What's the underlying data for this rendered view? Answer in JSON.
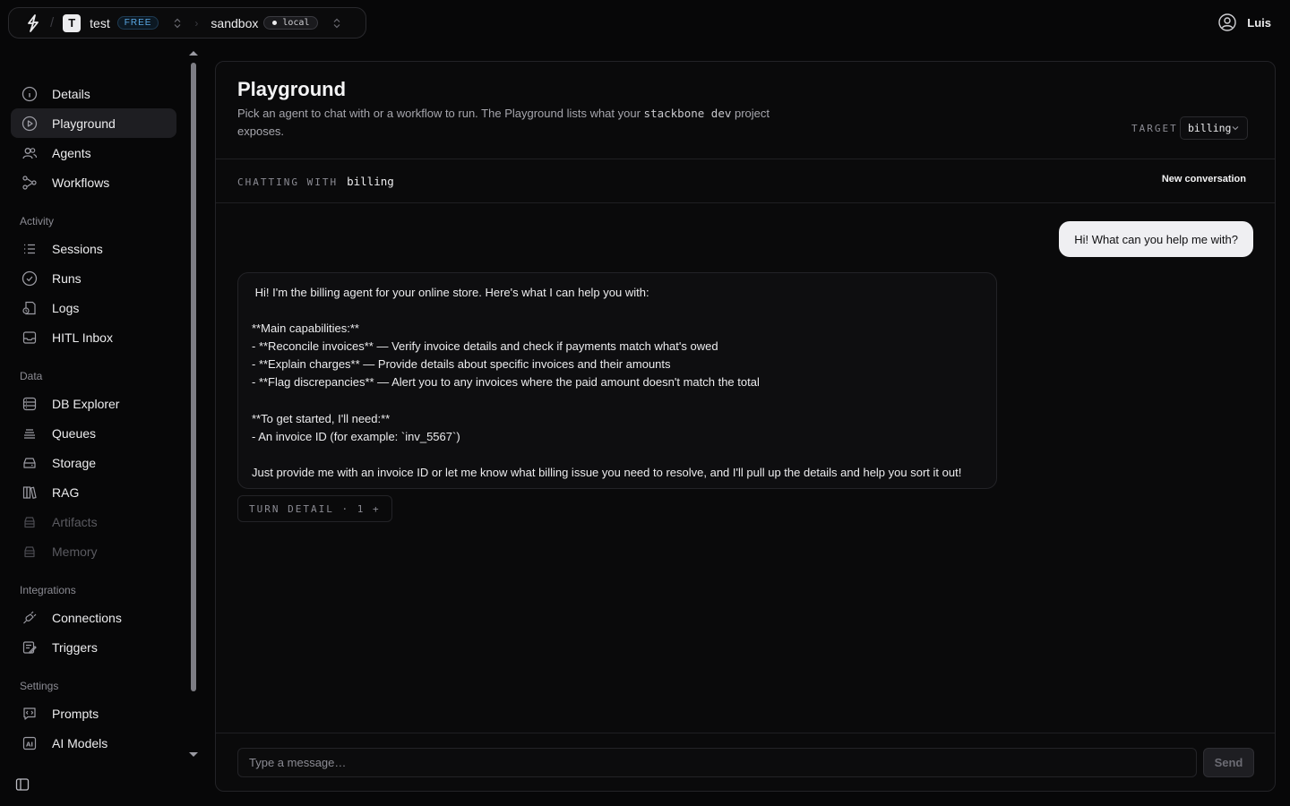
{
  "switcher": {
    "org_initial": "T",
    "org_name": "test",
    "plan_badge": "FREE",
    "env_name": "sandbox",
    "env_badge": "local"
  },
  "user": {
    "name": "Luis"
  },
  "sidebar": {
    "items": [
      {
        "label": "Details",
        "icon": "info-icon"
      },
      {
        "label": "Playground",
        "icon": "play-circle-icon",
        "active": true
      },
      {
        "label": "Agents",
        "icon": "users-icon"
      },
      {
        "label": "Workflows",
        "icon": "workflow-icon"
      }
    ],
    "sections": [
      {
        "title": "Activity",
        "items": [
          {
            "label": "Sessions",
            "icon": "list-icon"
          },
          {
            "label": "Runs",
            "icon": "check-circle-icon"
          },
          {
            "label": "Logs",
            "icon": "logs-icon"
          },
          {
            "label": "HITL Inbox",
            "icon": "inbox-icon"
          }
        ]
      },
      {
        "title": "Data",
        "items": [
          {
            "label": "DB Explorer",
            "icon": "database-icon"
          },
          {
            "label": "Queues",
            "icon": "queue-icon"
          },
          {
            "label": "Storage",
            "icon": "storage-icon"
          },
          {
            "label": "RAG",
            "icon": "books-icon"
          },
          {
            "label": "Artifacts",
            "icon": "artifacts-icon",
            "disabled": true
          },
          {
            "label": "Memory",
            "icon": "memory-icon",
            "disabled": true
          }
        ]
      },
      {
        "title": "Integrations",
        "items": [
          {
            "label": "Connections",
            "icon": "plug-icon"
          },
          {
            "label": "Triggers",
            "icon": "triggers-icon"
          }
        ]
      },
      {
        "title": "Settings",
        "items": [
          {
            "label": "Prompts",
            "icon": "prompts-icon"
          },
          {
            "label": "AI Models",
            "icon": "ai-models-icon"
          }
        ]
      }
    ]
  },
  "main": {
    "title": "Playground",
    "subtitle_pre": "Pick an agent to chat with or a workflow to run. The Playground lists what your ",
    "subtitle_code": "stackbone dev",
    "subtitle_post": " project exposes.",
    "target_label": "TARGET",
    "target_value": "billing",
    "chatting_label": "CHATTING WITH",
    "chatting_agent": "billing",
    "new_conversation": "New conversation",
    "messages": {
      "user": "Hi! What can you help me with?",
      "agent_lines": [
        " Hi! I'm the billing agent for your online store. Here's what I can help you with:",
        "",
        "**Main capabilities:**",
        "- **Reconcile invoices** — Verify invoice details and check if payments match what's owed",
        "- **Explain charges** — Provide details about specific invoices and their amounts",
        "- **Flag discrepancies** — Alert you to any invoices where the paid amount doesn't match the total",
        "",
        "**To get started, I'll need:**",
        "- An invoice ID (for example: `inv_5567`)",
        "",
        "Just provide me with an invoice ID or let me know what billing issue you need to resolve, and I'll pull up the details and help you sort it out!"
      ]
    },
    "turn_detail": "TURN DETAIL · 1 +",
    "composer": {
      "placeholder": "Type a message…",
      "send_label": "Send"
    }
  }
}
